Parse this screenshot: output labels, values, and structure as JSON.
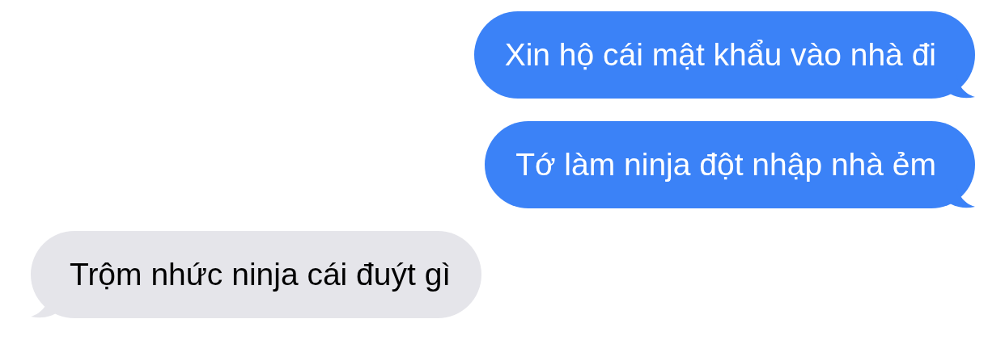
{
  "messages": [
    {
      "kind": "sent",
      "text": "Xin hộ cái mật khẩu vào nhà đi"
    },
    {
      "kind": "sent",
      "text": "Tớ làm ninja đột nhập nhà ẻm"
    },
    {
      "kind": "received",
      "text": "Trộm nhức ninja cái đuýt gì"
    }
  ]
}
